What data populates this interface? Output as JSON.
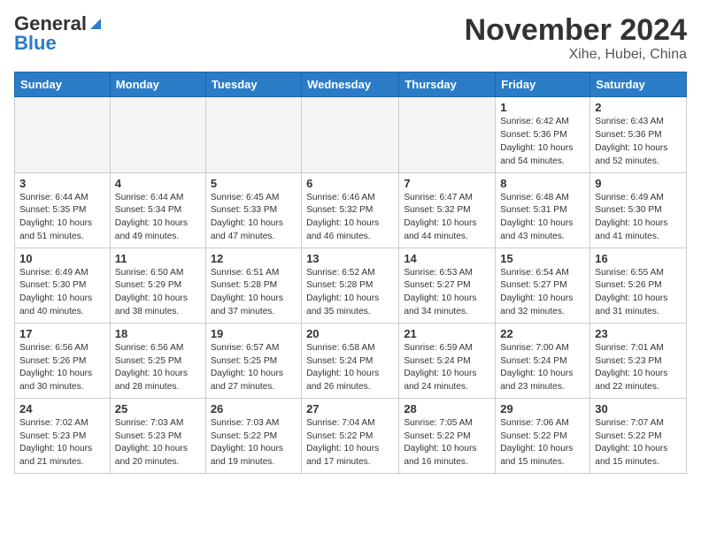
{
  "header": {
    "logo_general": "General",
    "logo_blue": "Blue",
    "month": "November 2024",
    "location": "Xihe, Hubei, China"
  },
  "days_of_week": [
    "Sunday",
    "Monday",
    "Tuesday",
    "Wednesday",
    "Thursday",
    "Friday",
    "Saturday"
  ],
  "weeks": [
    [
      {
        "day": "",
        "info": ""
      },
      {
        "day": "",
        "info": ""
      },
      {
        "day": "",
        "info": ""
      },
      {
        "day": "",
        "info": ""
      },
      {
        "day": "",
        "info": ""
      },
      {
        "day": "1",
        "info": "Sunrise: 6:42 AM\nSunset: 5:36 PM\nDaylight: 10 hours\nand 54 minutes."
      },
      {
        "day": "2",
        "info": "Sunrise: 6:43 AM\nSunset: 5:36 PM\nDaylight: 10 hours\nand 52 minutes."
      }
    ],
    [
      {
        "day": "3",
        "info": "Sunrise: 6:44 AM\nSunset: 5:35 PM\nDaylight: 10 hours\nand 51 minutes."
      },
      {
        "day": "4",
        "info": "Sunrise: 6:44 AM\nSunset: 5:34 PM\nDaylight: 10 hours\nand 49 minutes."
      },
      {
        "day": "5",
        "info": "Sunrise: 6:45 AM\nSunset: 5:33 PM\nDaylight: 10 hours\nand 47 minutes."
      },
      {
        "day": "6",
        "info": "Sunrise: 6:46 AM\nSunset: 5:32 PM\nDaylight: 10 hours\nand 46 minutes."
      },
      {
        "day": "7",
        "info": "Sunrise: 6:47 AM\nSunset: 5:32 PM\nDaylight: 10 hours\nand 44 minutes."
      },
      {
        "day": "8",
        "info": "Sunrise: 6:48 AM\nSunset: 5:31 PM\nDaylight: 10 hours\nand 43 minutes."
      },
      {
        "day": "9",
        "info": "Sunrise: 6:49 AM\nSunset: 5:30 PM\nDaylight: 10 hours\nand 41 minutes."
      }
    ],
    [
      {
        "day": "10",
        "info": "Sunrise: 6:49 AM\nSunset: 5:30 PM\nDaylight: 10 hours\nand 40 minutes."
      },
      {
        "day": "11",
        "info": "Sunrise: 6:50 AM\nSunset: 5:29 PM\nDaylight: 10 hours\nand 38 minutes."
      },
      {
        "day": "12",
        "info": "Sunrise: 6:51 AM\nSunset: 5:28 PM\nDaylight: 10 hours\nand 37 minutes."
      },
      {
        "day": "13",
        "info": "Sunrise: 6:52 AM\nSunset: 5:28 PM\nDaylight: 10 hours\nand 35 minutes."
      },
      {
        "day": "14",
        "info": "Sunrise: 6:53 AM\nSunset: 5:27 PM\nDaylight: 10 hours\nand 34 minutes."
      },
      {
        "day": "15",
        "info": "Sunrise: 6:54 AM\nSunset: 5:27 PM\nDaylight: 10 hours\nand 32 minutes."
      },
      {
        "day": "16",
        "info": "Sunrise: 6:55 AM\nSunset: 5:26 PM\nDaylight: 10 hours\nand 31 minutes."
      }
    ],
    [
      {
        "day": "17",
        "info": "Sunrise: 6:56 AM\nSunset: 5:26 PM\nDaylight: 10 hours\nand 30 minutes."
      },
      {
        "day": "18",
        "info": "Sunrise: 6:56 AM\nSunset: 5:25 PM\nDaylight: 10 hours\nand 28 minutes."
      },
      {
        "day": "19",
        "info": "Sunrise: 6:57 AM\nSunset: 5:25 PM\nDaylight: 10 hours\nand 27 minutes."
      },
      {
        "day": "20",
        "info": "Sunrise: 6:58 AM\nSunset: 5:24 PM\nDaylight: 10 hours\nand 26 minutes."
      },
      {
        "day": "21",
        "info": "Sunrise: 6:59 AM\nSunset: 5:24 PM\nDaylight: 10 hours\nand 24 minutes."
      },
      {
        "day": "22",
        "info": "Sunrise: 7:00 AM\nSunset: 5:24 PM\nDaylight: 10 hours\nand 23 minutes."
      },
      {
        "day": "23",
        "info": "Sunrise: 7:01 AM\nSunset: 5:23 PM\nDaylight: 10 hours\nand 22 minutes."
      }
    ],
    [
      {
        "day": "24",
        "info": "Sunrise: 7:02 AM\nSunset: 5:23 PM\nDaylight: 10 hours\nand 21 minutes."
      },
      {
        "day": "25",
        "info": "Sunrise: 7:03 AM\nSunset: 5:23 PM\nDaylight: 10 hours\nand 20 minutes."
      },
      {
        "day": "26",
        "info": "Sunrise: 7:03 AM\nSunset: 5:22 PM\nDaylight: 10 hours\nand 19 minutes."
      },
      {
        "day": "27",
        "info": "Sunrise: 7:04 AM\nSunset: 5:22 PM\nDaylight: 10 hours\nand 17 minutes."
      },
      {
        "day": "28",
        "info": "Sunrise: 7:05 AM\nSunset: 5:22 PM\nDaylight: 10 hours\nand 16 minutes."
      },
      {
        "day": "29",
        "info": "Sunrise: 7:06 AM\nSunset: 5:22 PM\nDaylight: 10 hours\nand 15 minutes."
      },
      {
        "day": "30",
        "info": "Sunrise: 7:07 AM\nSunset: 5:22 PM\nDaylight: 10 hours\nand 15 minutes."
      }
    ]
  ]
}
